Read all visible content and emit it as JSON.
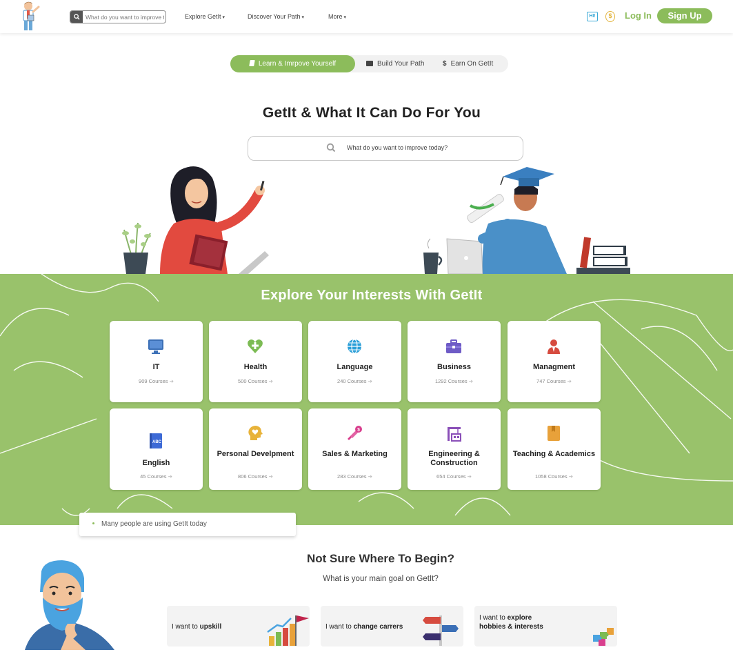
{
  "header": {
    "search_placeholder": "What do you want to improve today?",
    "nav": [
      {
        "label": "Explore GetIt"
      },
      {
        "label": "Discover Your Path"
      },
      {
        "label": "More"
      }
    ],
    "hi_badge": "HI!",
    "coin_symbol": "$",
    "login_label": "Log In",
    "signup_label": "Sign Up"
  },
  "tabs": [
    {
      "label": "Learn & Imrpove Yourself",
      "icon": "book-icon",
      "active": true
    },
    {
      "label": "Build Your Path",
      "icon": "briefcase-icon"
    },
    {
      "label": "Earn On GetIt",
      "icon": "dollar-icon"
    }
  ],
  "hero": {
    "title": "GetIt & What It Can Do For You",
    "search_placeholder": "What do you want to improve today?"
  },
  "explore": {
    "title": "Explore Your Interests With GetIt",
    "categories": [
      {
        "name": "IT",
        "courses": "909 Courses",
        "icon": "monitor-icon",
        "color": "#3b6fb6"
      },
      {
        "name": "Health",
        "courses": "500 Courses",
        "icon": "heart-plus-icon",
        "color": "#7cbb54"
      },
      {
        "name": "Language",
        "courses": "240 Courses",
        "icon": "globe-icon",
        "color": "#2b9fd8"
      },
      {
        "name": "Business",
        "courses": "1292 Courses",
        "icon": "briefcase-icon",
        "color": "#6e5bc6"
      },
      {
        "name": "Managment",
        "courses": "747 Courses",
        "icon": "manager-icon",
        "color": "#d64b3f"
      },
      {
        "name": "English",
        "courses": "45 Courses",
        "icon": "abc-book-icon",
        "color": "#3d6ad6"
      },
      {
        "name": "Personal Develpment",
        "courses": "806 Courses",
        "icon": "head-heart-icon",
        "color": "#e8b33a"
      },
      {
        "name": "Sales & Marketing",
        "courses": "283 Courses",
        "icon": "megaphone-icon",
        "color": "#d93f8e"
      },
      {
        "name": "Engineering & Construction",
        "courses": "654 Courses",
        "icon": "crane-icon",
        "color": "#8a4fb8"
      },
      {
        "name": "Teaching & Academics",
        "courses": "1058 Courses",
        "icon": "notebook-icon",
        "color": "#e8a13a"
      }
    ]
  },
  "notice": "Many people are using GetIt today",
  "begin": {
    "title": "Not Sure Where To Begin?",
    "subtitle": "What is your main goal on GetIt?",
    "goals": [
      {
        "prefix": "I want to",
        "bold": "upskill",
        "icon": "growth-chart-icon"
      },
      {
        "prefix": "I want to",
        "bold": "change carrers",
        "icon": "signpost-icon"
      },
      {
        "prefix": "I want to",
        "bold": "explore",
        "rest": "hobbies & interests",
        "icon": "puzzle-icon"
      }
    ]
  }
}
